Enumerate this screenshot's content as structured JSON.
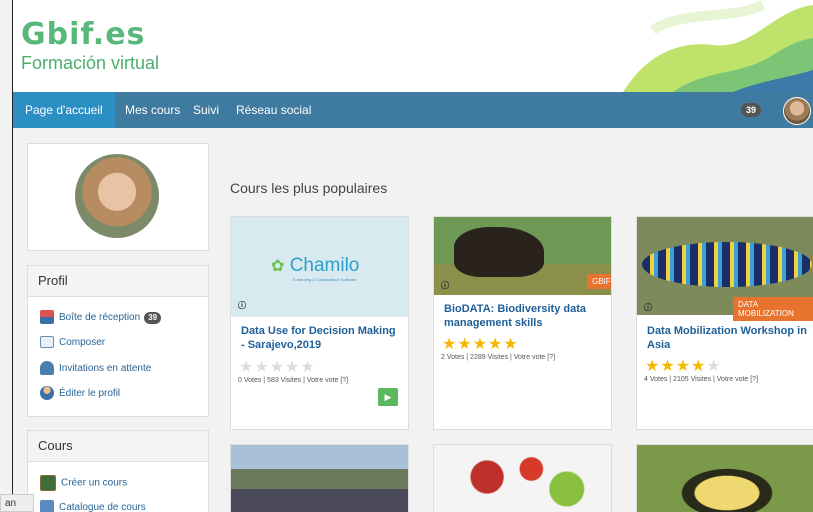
{
  "header": {
    "logo_main": "Gbif.es",
    "logo_sub": "Formación virtual"
  },
  "navbar": {
    "items": [
      {
        "label": "Page d'accueil",
        "active": true
      },
      {
        "label": "Mes cours"
      },
      {
        "label": "Suivi"
      },
      {
        "label": "Réseau social"
      }
    ],
    "notification_count": "39"
  },
  "sidebar": {
    "profile_title": "Profil",
    "profile_items": [
      {
        "label": "Boîte de réception",
        "badge": "39",
        "icon": "inbox-icon"
      },
      {
        "label": "Composer",
        "icon": "envelope-icon"
      },
      {
        "label": "Invitations en attente",
        "icon": "invitation-icon"
      },
      {
        "label": "Éditer le profil",
        "icon": "user-edit-icon"
      }
    ],
    "courses_title": "Cours",
    "course_items": [
      {
        "label": "Créer un cours",
        "icon": "create-course-icon"
      },
      {
        "label": "Catalogue de cours",
        "icon": "catalog-icon"
      }
    ]
  },
  "main": {
    "title": "Cours les plus populaires",
    "cards": [
      {
        "title": "Data Use for Decision Making - Sarajevo,2019",
        "stats": "0 Votes | 583 Visites | Votre vote [?]",
        "rating": 0,
        "image_text": "Chamilo",
        "image_subtext": "E-learning & Collaboration Software"
      },
      {
        "title": "BioDATA: Biodiversity data management skills",
        "stats": "2 Votes | 2289 Visites | Votre vote [?]",
        "rating": 5,
        "tag": "GBIF"
      },
      {
        "title": "Data Mobilization Workshop in Asia",
        "stats": "4 Votes | 2105 Visites | Votre vote [?]",
        "rating": 4,
        "tag": "DATA MOBILIZATION"
      }
    ]
  },
  "footer": {
    "lang": "an"
  },
  "colors": {
    "nav": "#3f7aa0",
    "nav_active": "#2b8fc4",
    "brand_green": "#57b87a",
    "link": "#1f5f99",
    "tag": "#e8732f",
    "star": "#f5b800"
  }
}
